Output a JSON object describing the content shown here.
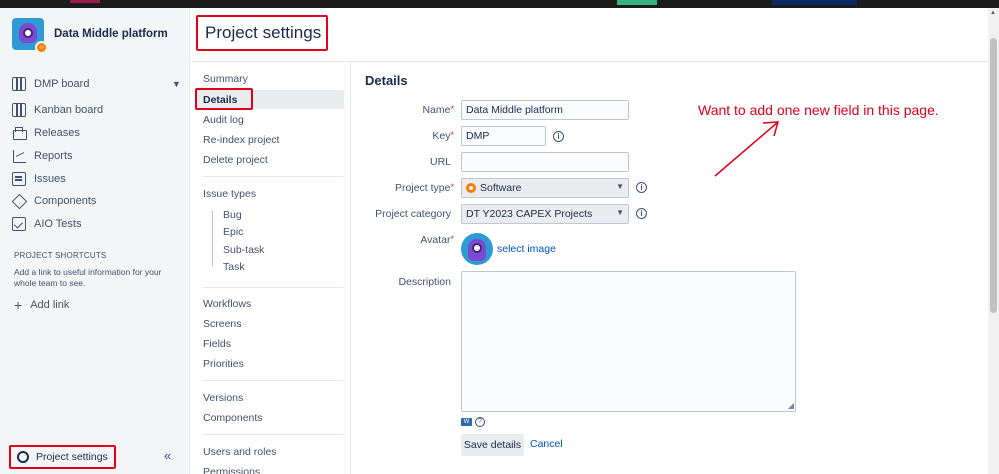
{
  "sidebar": {
    "project_name": "Data Middle platform",
    "board_selector": "DMP board",
    "items": [
      {
        "label": "Kanban board",
        "icon": "kanban-board-icon"
      },
      {
        "label": "Releases",
        "icon": "releases-icon"
      },
      {
        "label": "Reports",
        "icon": "reports-icon"
      },
      {
        "label": "Issues",
        "icon": "issues-icon"
      },
      {
        "label": "Components",
        "icon": "components-icon"
      },
      {
        "label": "AIO Tests",
        "icon": "aio-tests-icon"
      }
    ],
    "shortcuts_title": "PROJECT SHORTCUTS",
    "shortcuts_desc": "Add a link to useful information for your whole team to see.",
    "add_link": "Add link",
    "project_settings": "Project settings",
    "collapse_glyph": "«"
  },
  "header": {
    "title": "Project settings"
  },
  "settings_nav": {
    "group1": [
      "Summary",
      "Details",
      "Audit log",
      "Re-index project",
      "Delete project"
    ],
    "issue_types": "Issue types",
    "issue_type_items": [
      "Bug",
      "Epic",
      "Sub-task",
      "Task"
    ],
    "group3": [
      "Workflows",
      "Screens",
      "Fields",
      "Priorities"
    ],
    "group4": [
      "Versions",
      "Components"
    ],
    "group5": [
      "Users and roles",
      "Permissions"
    ]
  },
  "form": {
    "title": "Details",
    "name_label": "Name",
    "name_value": "Data Middle platform",
    "key_label": "Key",
    "key_value": "DMP",
    "url_label": "URL",
    "url_value": "",
    "project_type_label": "Project type",
    "project_type_value": "Software",
    "project_category_label": "Project category",
    "project_category_value": "DT Y2023 CAPEX Projects",
    "avatar_label": "Avatar",
    "select_image": "select image",
    "description_label": "Description",
    "save_button": "Save details",
    "cancel": "Cancel"
  },
  "annotation": {
    "text": "Want to add one new field in this page.",
    "color": "#e2001a"
  },
  "colors": {
    "highlight_box": "#e2001a",
    "link": "#0052cc",
    "sidebar_bg": "#f4f5f7"
  }
}
